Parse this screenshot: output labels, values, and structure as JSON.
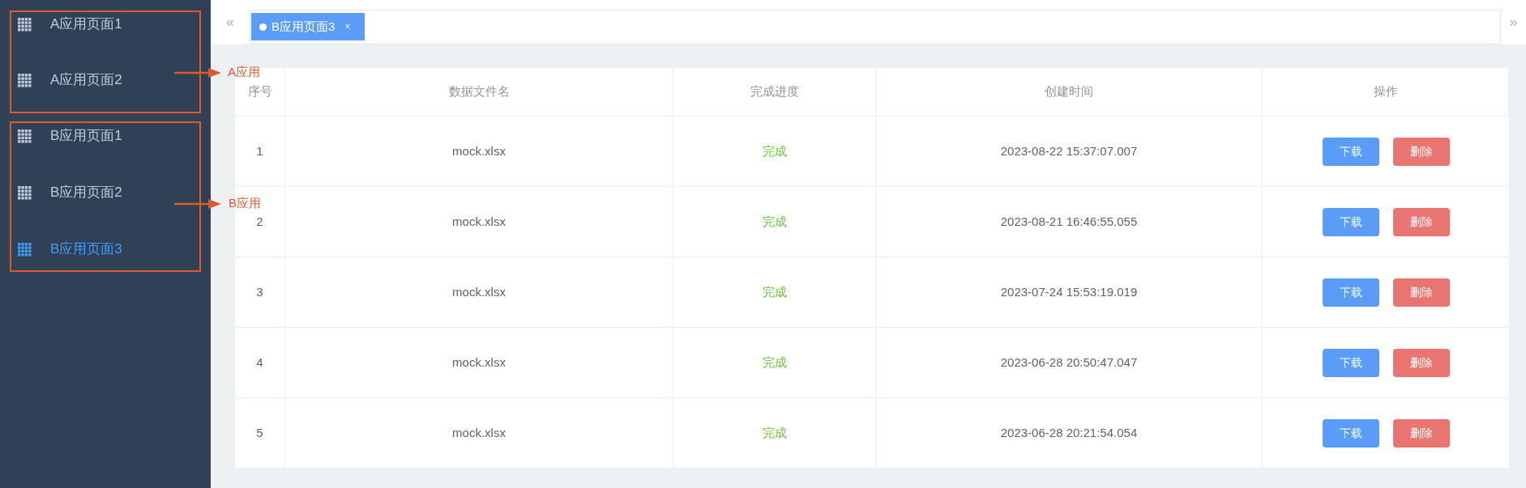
{
  "sidebar": {
    "groups": [
      {
        "annotation": "A应用",
        "items": [
          {
            "label": "A应用页面1",
            "selected": false
          },
          {
            "label": "A应用页面2",
            "selected": false
          }
        ]
      },
      {
        "annotation": "B应用",
        "items": [
          {
            "label": "B应用页面1",
            "selected": false
          },
          {
            "label": "B应用页面2",
            "selected": false
          },
          {
            "label": "B应用页面3",
            "selected": true
          }
        ]
      }
    ]
  },
  "tabs_bar": {
    "scroll_left": "«",
    "scroll_right": "»",
    "tabs": [
      {
        "label": "B应用页面3",
        "selected": true,
        "close": "×"
      }
    ]
  },
  "table": {
    "columns": [
      "序号",
      "数据文件名",
      "完成进度",
      "创建时间",
      "操作"
    ],
    "rows": [
      {
        "index": "1",
        "file": "mock.xlsx",
        "status": "完成",
        "created": "2023-08-22 15:37:07.007",
        "actions": [
          "下载",
          "删除"
        ]
      },
      {
        "index": "2",
        "file": "mock.xlsx",
        "status": "完成",
        "created": "2023-08-21 16:46:55.055",
        "actions": [
          "下载",
          "删除"
        ]
      },
      {
        "index": "3",
        "file": "mock.xlsx",
        "status": "完成",
        "created": "2023-07-24 15:53:19.019",
        "actions": [
          "下载",
          "删除"
        ]
      },
      {
        "index": "4",
        "file": "mock.xlsx",
        "status": "完成",
        "created": "2023-06-28 20:50:47.047",
        "actions": [
          "下载",
          "删除"
        ]
      },
      {
        "index": "5",
        "file": "mock.xlsx",
        "status": "完成",
        "created": "2023-06-28 20:21:54.054",
        "actions": [
          "下载",
          "删除"
        ]
      }
    ]
  }
}
